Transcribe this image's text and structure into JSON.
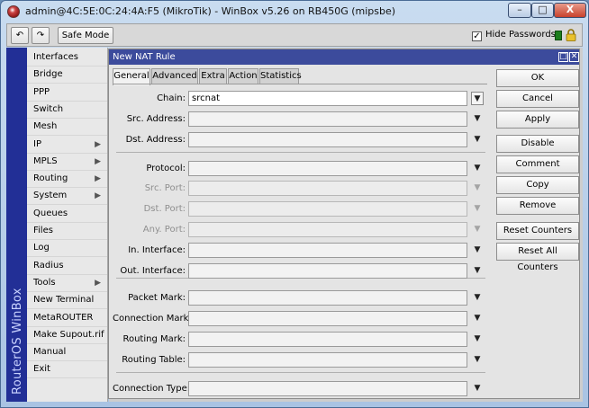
{
  "window": {
    "title": "admin@4C:5E:0C:24:4A:F5 (MikroTik) - WinBox v5.26 on RB450G (mipsbe)",
    "controls": {
      "minimize": "–",
      "maximize": "□",
      "close": "X"
    }
  },
  "toolbar": {
    "undo_icon": "↶",
    "redo_icon": "↷",
    "safe_mode": "Safe Mode",
    "hide_passwords_label": "Hide Passwords",
    "hide_passwords_checked": "✓"
  },
  "brand": {
    "text": "RouterOS WinBox"
  },
  "sidebar": {
    "items": [
      {
        "label": "Interfaces",
        "arrow": ""
      },
      {
        "label": "Bridge",
        "arrow": ""
      },
      {
        "label": "PPP",
        "arrow": ""
      },
      {
        "label": "Switch",
        "arrow": ""
      },
      {
        "label": "Mesh",
        "arrow": ""
      },
      {
        "label": "IP",
        "arrow": "▶"
      },
      {
        "label": "MPLS",
        "arrow": "▶"
      },
      {
        "label": "Routing",
        "arrow": "▶"
      },
      {
        "label": "System",
        "arrow": "▶"
      },
      {
        "label": "Queues",
        "arrow": ""
      },
      {
        "label": "Files",
        "arrow": ""
      },
      {
        "label": "Log",
        "arrow": ""
      },
      {
        "label": "Radius",
        "arrow": ""
      },
      {
        "label": "Tools",
        "arrow": "▶"
      },
      {
        "label": "New Terminal",
        "arrow": ""
      },
      {
        "label": "MetaROUTER",
        "arrow": ""
      },
      {
        "label": "Make Supout.rif",
        "arrow": ""
      },
      {
        "label": "Manual",
        "arrow": ""
      },
      {
        "label": "Exit",
        "arrow": ""
      }
    ]
  },
  "dialog": {
    "title": "New NAT Rule",
    "max_icon": "□",
    "close_icon": "✕",
    "tabs": [
      "General",
      "Advanced",
      "Extra",
      "Action",
      "Statistics"
    ],
    "active_tab": "General",
    "fields": [
      {
        "label": "Chain:",
        "value": "srcnat",
        "dropdown": "▼"
      },
      {
        "label": "Src. Address:",
        "value": "",
        "dropdown": "▼"
      },
      {
        "label": "Dst. Address:",
        "value": "",
        "dropdown": "▼"
      },
      {
        "label": "Protocol:",
        "value": "",
        "dropdown": "▼"
      },
      {
        "label": "Src. Port:",
        "value": "",
        "dropdown": "▼"
      },
      {
        "label": "Dst. Port:",
        "value": "",
        "dropdown": "▼"
      },
      {
        "label": "Any. Port:",
        "value": "",
        "dropdown": "▼"
      },
      {
        "label": "In. Interface:",
        "value": "",
        "dropdown": "▼"
      },
      {
        "label": "Out. Interface:",
        "value": "",
        "dropdown": "▼"
      },
      {
        "label": "Packet Mark:",
        "value": "",
        "dropdown": "▼"
      },
      {
        "label": "Connection Mark:",
        "value": "",
        "dropdown": "▼"
      },
      {
        "label": "Routing Mark:",
        "value": "",
        "dropdown": "▼"
      },
      {
        "label": "Routing Table:",
        "value": "",
        "dropdown": "▼"
      },
      {
        "label": "Connection Type:",
        "value": "",
        "dropdown": "▼"
      }
    ],
    "buttons": [
      "OK",
      "Cancel",
      "Apply",
      "Disable",
      "Comment",
      "Copy",
      "Remove",
      "Reset Counters",
      "Reset All Counters"
    ]
  },
  "colors": {
    "title_bar": "#3c4b9c",
    "brand_strip": "#222f96",
    "status_square": "#1c7d1c"
  }
}
